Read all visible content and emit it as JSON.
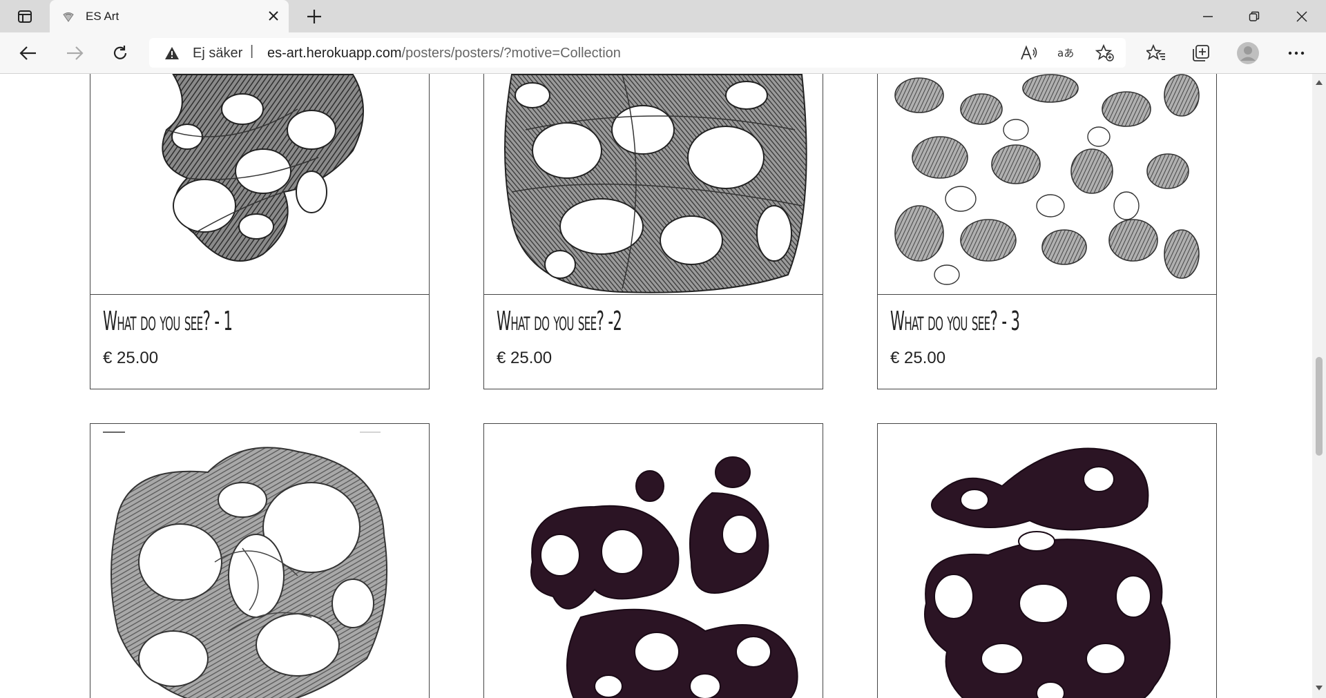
{
  "browser": {
    "tab_title": "ES Art",
    "security_label": "Ej säker",
    "url_host": "es-art.herokuapp.com",
    "url_path": "/posters/posters/?motive=Collection"
  },
  "products": [
    {
      "title": "What do you see? - 1",
      "price": "€ 25.00"
    },
    {
      "title": "What do you see? -2",
      "price": "€ 25.00"
    },
    {
      "title": "What do you see? - 3",
      "price": "€ 25.00"
    },
    {
      "title": "",
      "price": ""
    },
    {
      "title": "",
      "price": ""
    },
    {
      "title": "",
      "price": ""
    }
  ],
  "colors": {
    "tabstrip": "#dadada",
    "toolbar": "#f7f7f7",
    "ink_dark": "#2b1424",
    "pencil": "#5a5a5a"
  },
  "icons": [
    "sidebar-icon",
    "close-icon",
    "plus-icon",
    "back-icon",
    "forward-icon",
    "refresh-icon",
    "warning-icon",
    "read-aloud-icon",
    "translate-icon",
    "add-favorite-icon",
    "favorites-icon",
    "collections-icon",
    "profile-icon",
    "more-icon"
  ]
}
